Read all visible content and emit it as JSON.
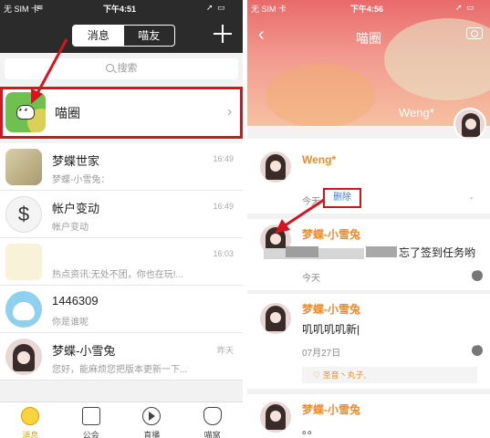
{
  "left": {
    "status": {
      "carrier": "无 SIM 卡",
      "time": "下午4:51"
    },
    "segment": {
      "left": "消息",
      "right": "喵友"
    },
    "search": {
      "placeholder": "搜索"
    },
    "miaoquan": {
      "label": "喵圈"
    },
    "items": [
      {
        "name": "梦蝶世家",
        "sub": "梦蝶-小雪兔：",
        "time": "16:49"
      },
      {
        "name": "帐户变动",
        "sub": "帐户变动",
        "time": "16:49"
      },
      {
        "name": "",
        "sub": "热点资讯:无处不团，你也在玩!...",
        "time": "16:03"
      },
      {
        "name": "1446309",
        "sub": "你是谁呢",
        "time": ""
      },
      {
        "name": "梦蝶-小雪兔",
        "sub": "您好，能麻烦您把版本更新一下...",
        "time": "昨天"
      }
    ],
    "tabs": [
      "消息",
      "公会",
      "直播",
      "喵窝"
    ]
  },
  "right": {
    "status": {
      "carrier": "无 SIM 卡",
      "time": "下午4:56"
    },
    "title": "喵圈",
    "cover_name": "Weng*",
    "post_author": "Weng*",
    "post_date": "今天",
    "delete_label": "删除",
    "posts": [
      {
        "name": "梦蝶-小雪兔",
        "text": "忘了签到任务哟",
        "date": "今天"
      },
      {
        "name": "梦蝶-小雪兔",
        "text": "叽叽叽叽新|",
        "date": "07月27日",
        "likes": "♡ 圣音丶丸子,"
      },
      {
        "name": "梦蝶-小雪兔",
        "text": "。。"
      }
    ]
  },
  "colors": {
    "accent_red": "#d6141f",
    "name_orange": "#f08a2a",
    "link_blue": "#3b7ed8"
  }
}
